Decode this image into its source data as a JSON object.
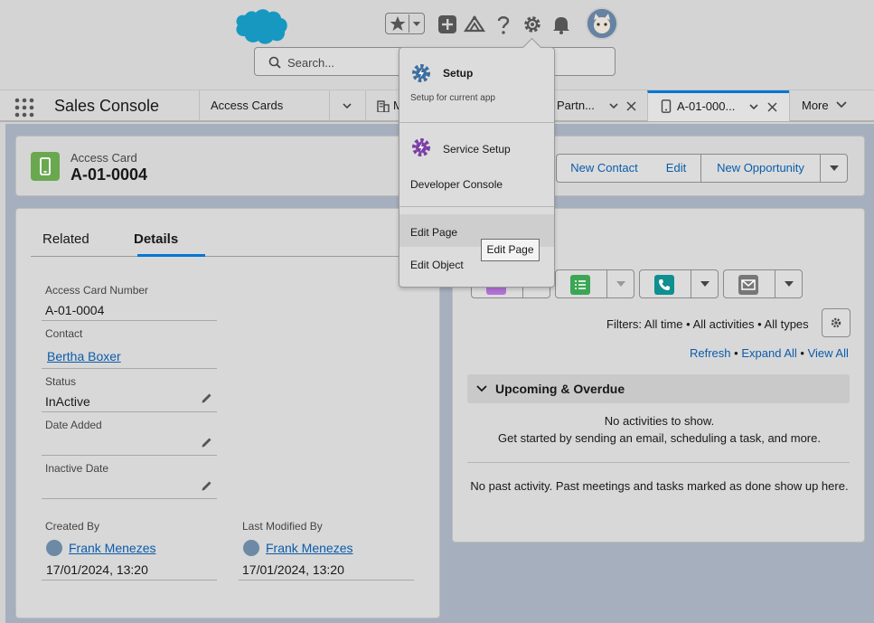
{
  "global_header": {
    "search_placeholder": "Search..."
  },
  "navbar": {
    "app_name": "Sales Console",
    "tabs": [
      {
        "label": "Access Cards"
      },
      {
        "label": "M"
      },
      {
        "label": "Partn..."
      },
      {
        "label": "A-01-000..."
      },
      {
        "label": "More"
      }
    ]
  },
  "record": {
    "entity_type": "Access Card",
    "name": "A-01-0004",
    "actions": [
      "New Contact",
      "Edit",
      "New Opportunity"
    ]
  },
  "details": {
    "tabs": [
      "Related",
      "Details"
    ],
    "fields": {
      "access_card_number_label": "Access Card Number",
      "access_card_number": "A-01-0004",
      "contact_label": "Contact",
      "contact": "Bertha Boxer",
      "status_label": "Status",
      "status": "InActive",
      "date_added_label": "Date Added",
      "inactive_date_label": "Inactive Date",
      "created_by_label": "Created By",
      "created_by": "Frank Menezes",
      "created_date": "17/01/2024, 13:20",
      "last_modified_label": "Last Modified By",
      "last_modified_by": "Frank Menezes",
      "last_modified_date": "17/01/2024, 13:20"
    }
  },
  "activity": {
    "filters": "Filters: All time • All activities • All types",
    "refresh": "Refresh",
    "expand_all": "Expand All",
    "view_all": "View All",
    "sep": "•",
    "section_title": "Upcoming & Overdue",
    "empty_line1": "No activities to show.",
    "empty_line2": "Get started by sending an email, scheduling a task, and more.",
    "past_text": "No past activity. Past meetings and tasks marked as done show up here."
  },
  "setup_menu": {
    "setup_title": "Setup",
    "setup_sub": "Setup for current app",
    "service_setup": "Service Setup",
    "developer_console": "Developer Console",
    "edit_page": "Edit Page",
    "edit_object": "Edit Object",
    "tooltip": "Edit Page"
  },
  "colors": {
    "brand_blue": "#0176d3",
    "link_blue": "#0b5cab",
    "entity_green": "#6aa84f",
    "salesforce_cloud": "#1798c1"
  }
}
